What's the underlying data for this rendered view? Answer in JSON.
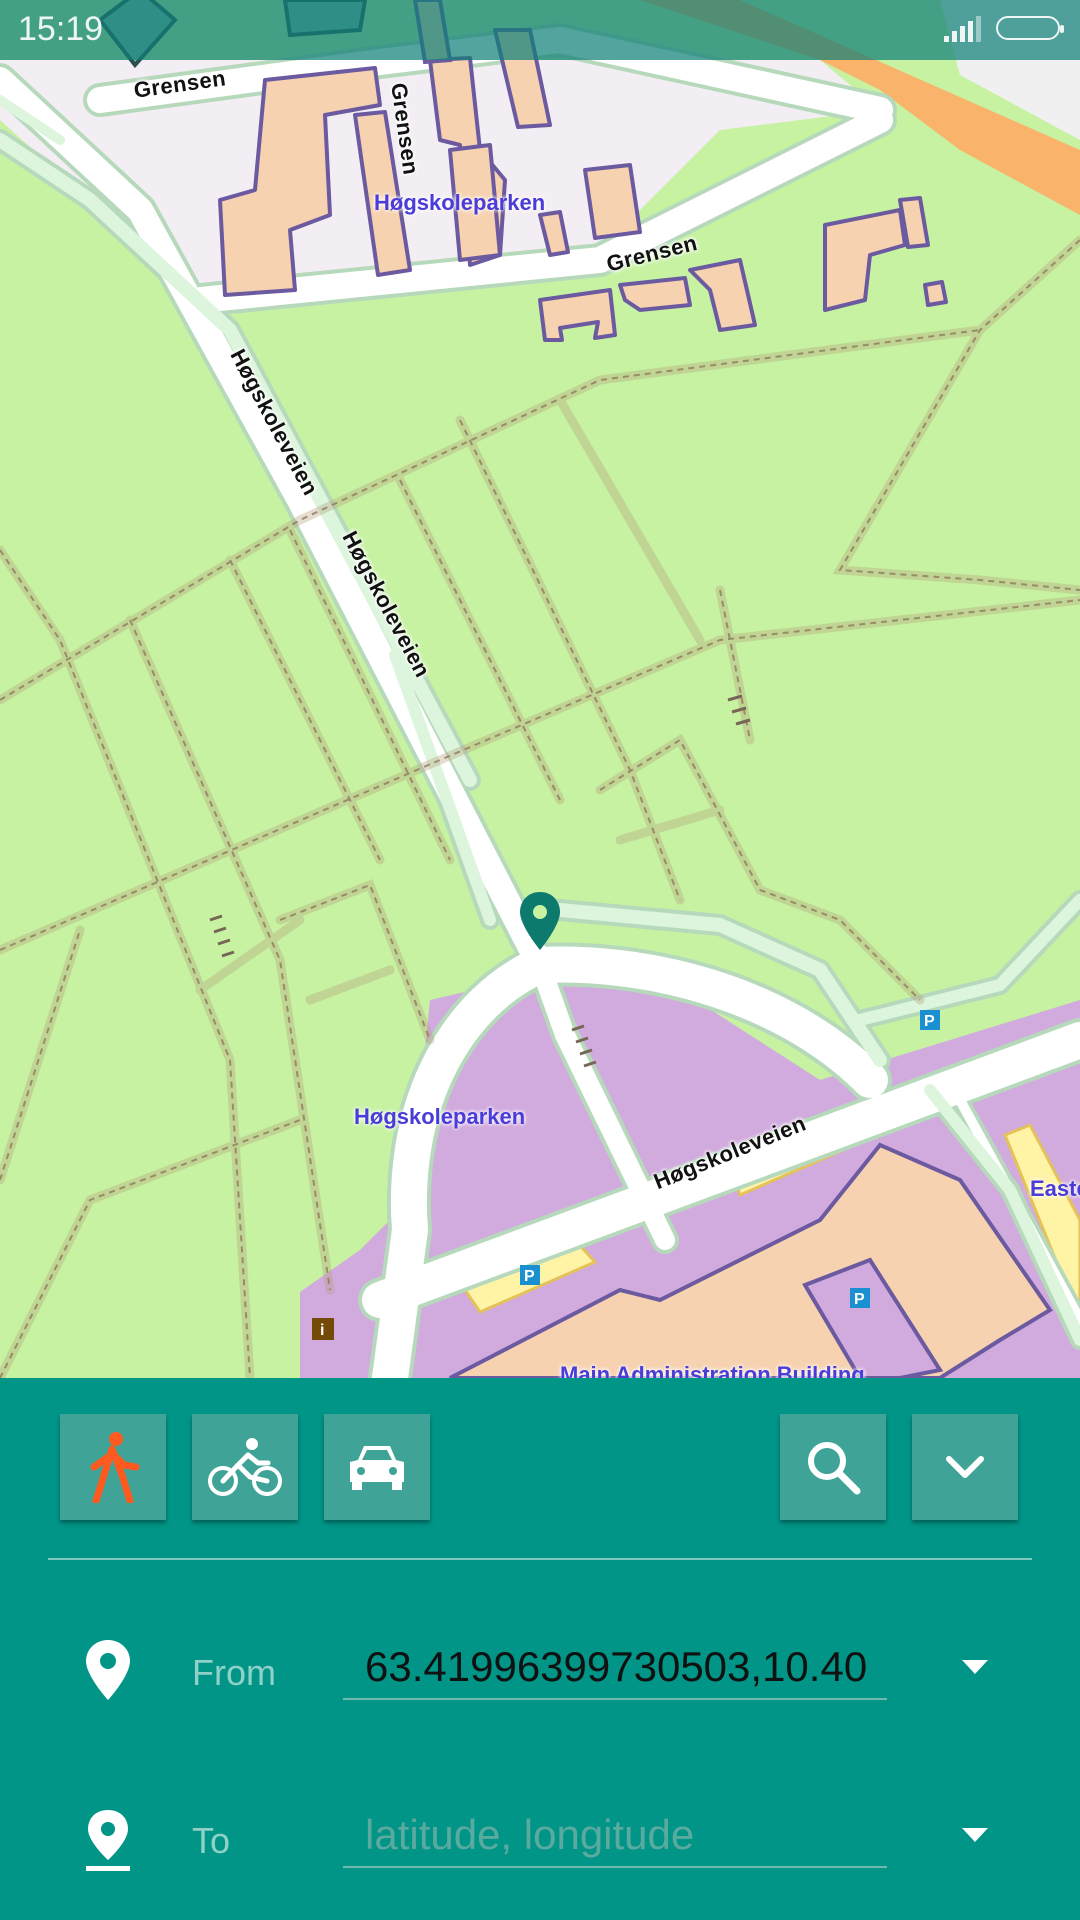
{
  "status_bar": {
    "time": "15:19"
  },
  "map": {
    "street_labels": {
      "grensen_top": "Grensen",
      "grensen_vertical": "Grensen",
      "grensen_right": "Grensen",
      "hogskoleveien_1": "Høgskoleveien",
      "hogskoleveien_2": "Høgskoleveien",
      "hogskoleveien_3": "Høgskoleveien"
    },
    "place_labels": {
      "park_top": "Høgskoleparken",
      "park_bottom": "Høgskoleparken",
      "east": "Easte",
      "main_admin": "Main Administration Building"
    },
    "parking_label": "P",
    "info_label": "i",
    "colors": {
      "park": "#c6f2a2",
      "road": "#ffffff",
      "road_casing": "#b8d8bc",
      "building": "#f6d2b1",
      "building_outline": "#6b5aa0",
      "university": "#d1aade",
      "residential": "#f3eef3",
      "primary_road": "#f9b36a",
      "marker": "#0e7a6e"
    }
  },
  "panel": {
    "modes": [
      {
        "name": "walk",
        "icon": "walk-icon",
        "color": "#ff5a1f"
      },
      {
        "name": "bike",
        "icon": "bike-icon"
      },
      {
        "name": "car",
        "icon": "car-icon"
      }
    ],
    "search_icon": "search-icon",
    "collapse_icon": "chevron-down-icon",
    "from": {
      "label": "From",
      "value": "63.41996399730503,10.40",
      "placeholder": ""
    },
    "to": {
      "label": "To",
      "value": "",
      "placeholder": "latitude, longitude"
    },
    "colors": {
      "background": "#009587",
      "button": "#3fa497"
    }
  }
}
